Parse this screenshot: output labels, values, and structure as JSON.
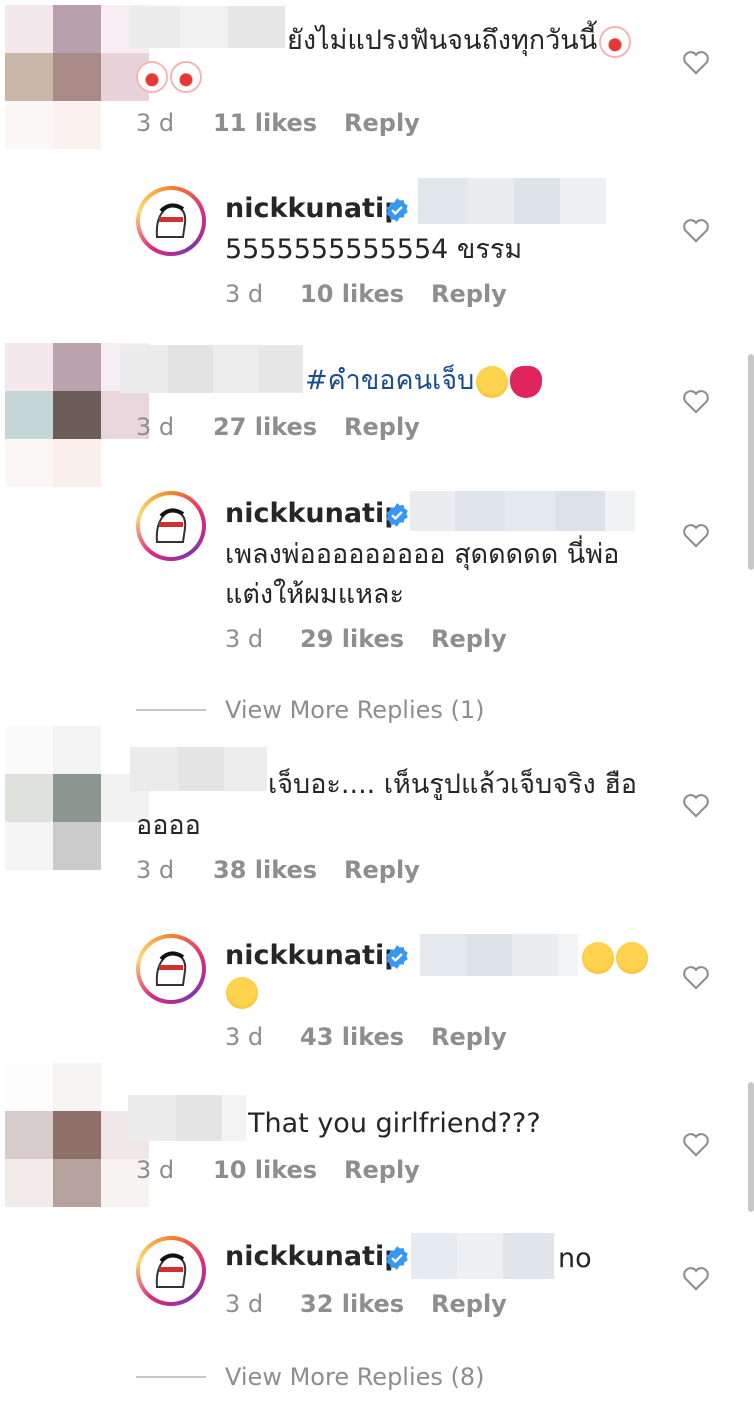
{
  "comments": [
    {
      "username": "",
      "text": "ยังไม่แปรงฟันจนถึงทุกวันนี้",
      "emoji": [
        "clown-face",
        "clown-face",
        "clown-face"
      ],
      "time": "3 d",
      "likes": "11 likes",
      "reply": "Reply"
    },
    {
      "username": "nickkunatip",
      "verified": true,
      "text": "5555555555554 ขรรม",
      "time": "3 d",
      "likes": "10 likes",
      "reply": "Reply"
    },
    {
      "username": "",
      "text": "#คำขอคนเจ็บ",
      "emoji": [
        "loudly-crying-face",
        "broken-heart"
      ],
      "time": "3 d",
      "likes": "27 likes",
      "reply": "Reply"
    },
    {
      "username": "nickkunatip",
      "verified": true,
      "text_line1": "เพลงพ่อออออออออ สุดดดดด นี่พ่อ",
      "text_line2": "แต่งให้ผมแหละ",
      "time": "3 d",
      "likes": "29 likes",
      "reply": "Reply"
    },
    {
      "username": "",
      "text_line1": "เจ็บอะ.... เห็นรูปแล้วเจ็บจริง ฮือ",
      "text_line2": "ออออ",
      "time": "3 d",
      "likes": "38 likes",
      "reply": "Reply"
    },
    {
      "username": "nickkunatip",
      "verified": true,
      "emoji": [
        "rolling-on-floor-laughing",
        "rolling-on-floor-laughing",
        "rolling-on-floor-laughing"
      ],
      "time": "3 d",
      "likes": "43 likes",
      "reply": "Reply"
    },
    {
      "username": "",
      "text": "That you girlfriend???",
      "time": "3 d",
      "likes": "10 likes",
      "reply": "Reply"
    },
    {
      "username": "nickkunatip",
      "verified": true,
      "text": "no",
      "time": "3 d",
      "likes": "32 likes",
      "reply": "Reply"
    }
  ],
  "view_more": [
    "View More Replies (1)",
    "View More Replies (8)"
  ],
  "colors": {
    "verified_badge": "#3897f0",
    "meta_text": "#8e8e8e",
    "hashtag": "#1a4e8c"
  },
  "icons": {
    "like": "heart-outline-icon",
    "verified": "verified-badge-icon"
  }
}
